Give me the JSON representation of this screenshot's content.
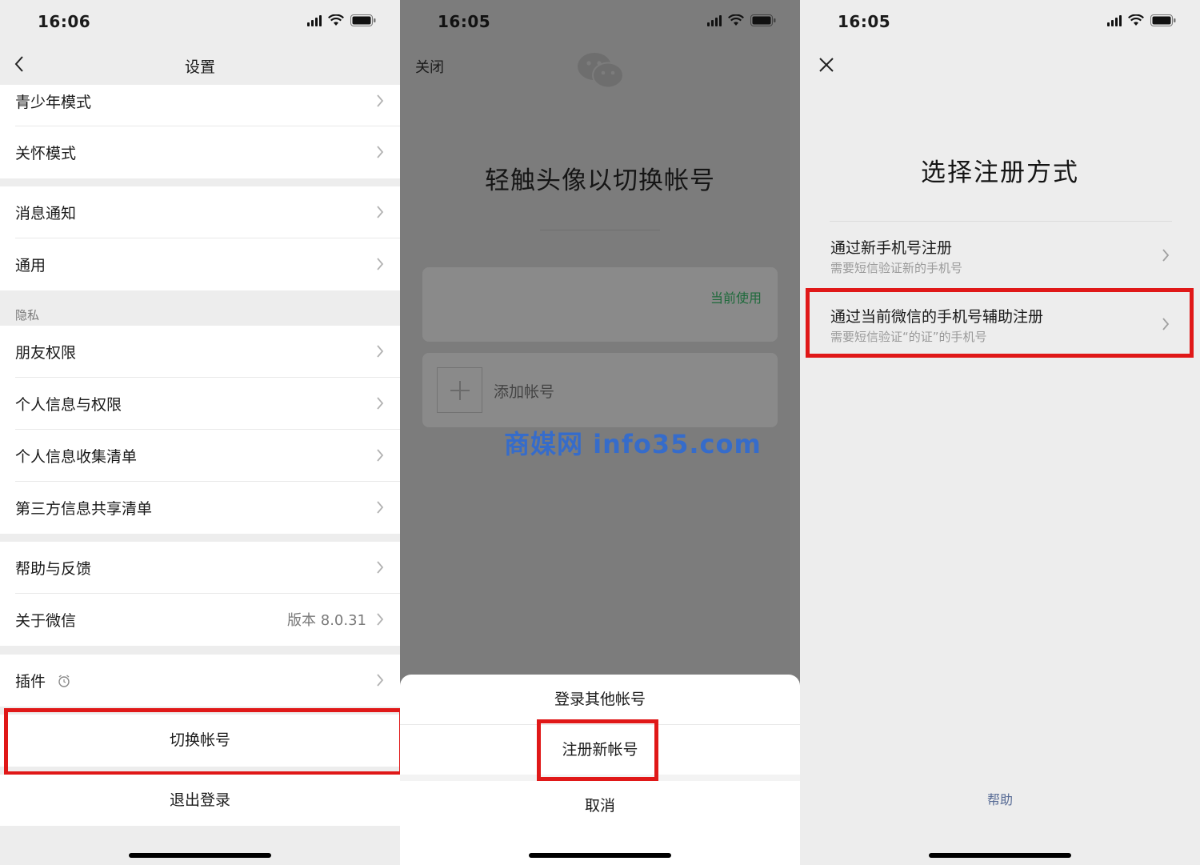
{
  "panel1": {
    "time": "16:06",
    "title": "设置",
    "rows": [
      {
        "label": "青少年模式"
      },
      {
        "label": "关怀模式"
      },
      {
        "label": "消息通知"
      },
      {
        "label": "通用"
      },
      {
        "label": "朋友权限"
      },
      {
        "label": "个人信息与权限"
      },
      {
        "label": "个人信息收集清单"
      },
      {
        "label": "第三方信息共享清单"
      },
      {
        "label": "帮助与反馈"
      },
      {
        "label": "关于微信",
        "value": "版本 8.0.31"
      },
      {
        "label": "插件"
      }
    ],
    "privacy_group": "隐私",
    "switch_account": "切换帐号",
    "logout": "退出登录"
  },
  "panel2": {
    "time": "16:05",
    "close": "关闭",
    "title": "轻触头像以切换帐号",
    "current_badge": "当前使用",
    "add_account": "添加帐号",
    "watermark": "商媒网 info35.com",
    "sheet": {
      "login_other": "登录其他帐号",
      "register_new": "注册新帐号",
      "cancel": "取消"
    }
  },
  "panel3": {
    "time": "16:05",
    "title": "选择注册方式",
    "options": [
      {
        "title": "通过新手机号注册",
        "subtitle": "需要短信验证新的手机号"
      },
      {
        "title": "通过当前微信的手机号辅助注册",
        "subtitle": "需要短信验证“的证”的手机号"
      }
    ],
    "help": "帮助"
  },
  "colors": {
    "highlight": "#e01818",
    "accent_green": "#1f6a3c",
    "link_blue": "#576b95",
    "watermark_blue": "#2f6bd3"
  }
}
